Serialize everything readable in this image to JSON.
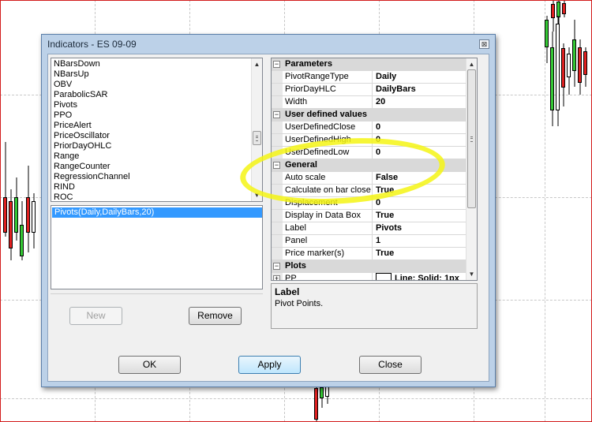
{
  "dialog": {
    "title": "Indicators - ES 09-09",
    "close_glyph": "⊠"
  },
  "indicator_list": {
    "items": [
      "NBarsDown",
      "NBarsUp",
      "OBV",
      "ParabolicSAR",
      "Pivots",
      "PPO",
      "PriceAlert",
      "PriceOscillator",
      "PriorDayOHLC",
      "Range",
      "RangeCounter",
      "RegressionChannel",
      "RIND",
      "ROC"
    ]
  },
  "applied_list": {
    "items": [
      "Pivots(Daily,DailyBars,20)"
    ]
  },
  "buttons": {
    "new": "New",
    "remove": "Remove",
    "ok": "OK",
    "apply": "Apply",
    "close": "Close"
  },
  "properties": {
    "parameters": {
      "title": "Parameters",
      "rows": [
        {
          "key": "PivotRangeType",
          "value": "Daily"
        },
        {
          "key": "PriorDayHLC",
          "value": "DailyBars"
        },
        {
          "key": "Width",
          "value": "20"
        }
      ]
    },
    "user_defined": {
      "title": "User defined values",
      "rows": [
        {
          "key": "UserDefinedClose",
          "value": "0"
        },
        {
          "key": "UserDefinedHigh",
          "value": "0"
        },
        {
          "key": "UserDefinedLow",
          "value": "0"
        }
      ]
    },
    "general": {
      "title": "General",
      "rows": [
        {
          "key": "Auto scale",
          "value": "False"
        },
        {
          "key": "Calculate on bar close",
          "value": "True"
        },
        {
          "key": "Displacement",
          "value": "0"
        },
        {
          "key": "Display in Data Box",
          "value": "True"
        },
        {
          "key": "Label",
          "value": "Pivots"
        },
        {
          "key": "Panel",
          "value": "1"
        },
        {
          "key": "Price marker(s)",
          "value": "True"
        }
      ]
    },
    "plots": {
      "title": "Plots",
      "rows": [
        {
          "key": "PP",
          "value": "Line; Solid; 1px"
        }
      ]
    }
  },
  "description": {
    "title": "Label",
    "text": "Pivot Points."
  },
  "colors": {
    "highlight": "#f5f514",
    "up_candle": "#35c935",
    "down_candle": "#e02020",
    "selection": "#3399ff"
  }
}
